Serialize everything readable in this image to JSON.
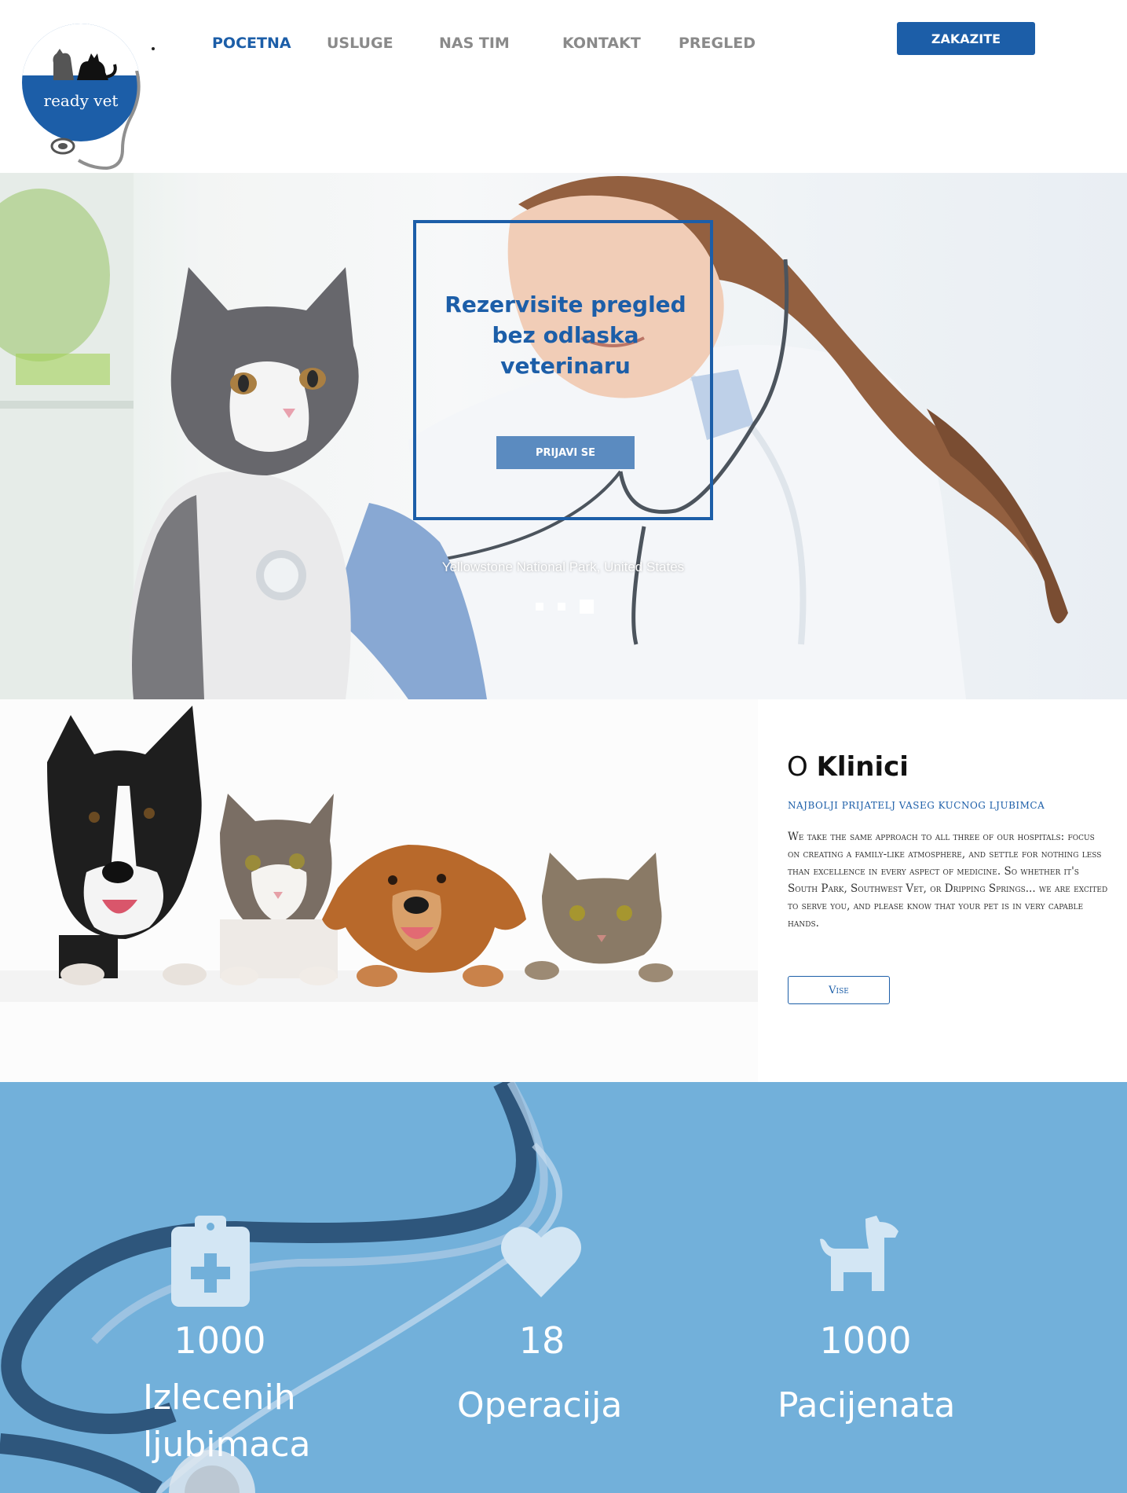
{
  "header": {
    "logo_text": "ready vet",
    "nav": [
      "POCETNA",
      "USLUGE",
      "NAS TIM",
      "KONTAKT",
      "PREGLED"
    ],
    "active_nav": "POCETNA",
    "cta": "ZAKAZITE"
  },
  "hero": {
    "title": "Rezervisite pregled bez odlaska veterinaru",
    "button": "PRIJAVI SE",
    "caption": "Yellowstone National Park, United States",
    "slides": 3,
    "active_slide": 3
  },
  "about": {
    "title_light": "O",
    "title_bold": "Klinici",
    "subtitle": "Najbolji prijatelj vaseg kucnog ljubimca",
    "body": "We take the same approach to all three of our hospitals: focus on creating a family-like atmosphere, and settle for nothing less than excellence in every aspect of medicine. So whether it's South Park, Southwest Vet, or Dripping Springs... we are excited to serve you, and please know that your pet is in very capable hands.",
    "button": "Vise"
  },
  "stats": [
    {
      "icon": "clipboard-medical-icon",
      "value": "1000",
      "label": "Izlecenih ljubimaca"
    },
    {
      "icon": "heart-icon",
      "value": "18",
      "label": "Operacija"
    },
    {
      "icon": "dog-icon",
      "value": "1000",
      "label": "Pacijenata"
    }
  ],
  "colors": {
    "brand": "#1c5ea8",
    "stats_bg": "#72b0da",
    "nav_inactive": "#8a8a8a"
  }
}
